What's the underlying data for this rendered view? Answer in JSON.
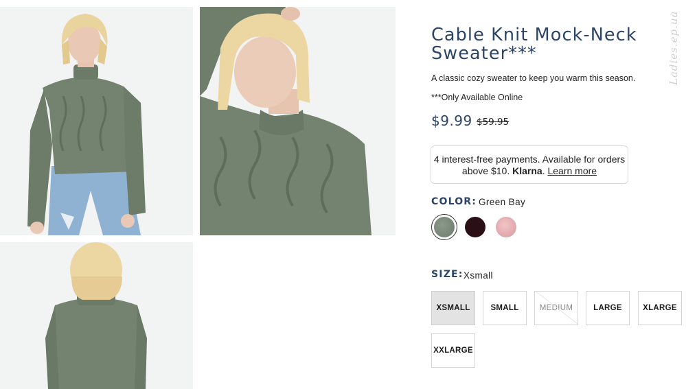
{
  "gallery": {
    "images": [
      {
        "alt": "model-front-view"
      },
      {
        "alt": "model-closeup-view"
      },
      {
        "alt": "model-back-view"
      }
    ]
  },
  "product": {
    "title": "Cable Knit Mock-Neck Sweater***",
    "description": "A classic cozy sweater to keep you warm this season.",
    "availability_note": "***Only Available Online",
    "price_current": "$9.99",
    "price_original": "$59.95",
    "klarna": {
      "text": "4 interest-free payments. Available for orders above $10.",
      "brand": "Klarna",
      "link": "Learn more"
    }
  },
  "color": {
    "label": "COLOR:",
    "selected": "Green Bay",
    "swatches": [
      {
        "name": "green-bay",
        "hex": "#7f8e7f"
      },
      {
        "name": "burgundy",
        "hex": "#2a0f17"
      },
      {
        "name": "pink",
        "hex": "#e6b0b4"
      }
    ]
  },
  "size": {
    "label": "SIZE:",
    "selected": "Xsmall",
    "options": [
      {
        "label": "XSMALL",
        "state": "selected"
      },
      {
        "label": "SMALL",
        "state": "available"
      },
      {
        "label": "MEDIUM",
        "state": "unavailable"
      },
      {
        "label": "LARGE",
        "state": "available"
      },
      {
        "label": "XLARGE",
        "state": "available"
      },
      {
        "label": "XXLARGE",
        "state": "available"
      }
    ]
  },
  "theme": {
    "accent": "#2c4566",
    "sweater_green": "#73826f"
  }
}
